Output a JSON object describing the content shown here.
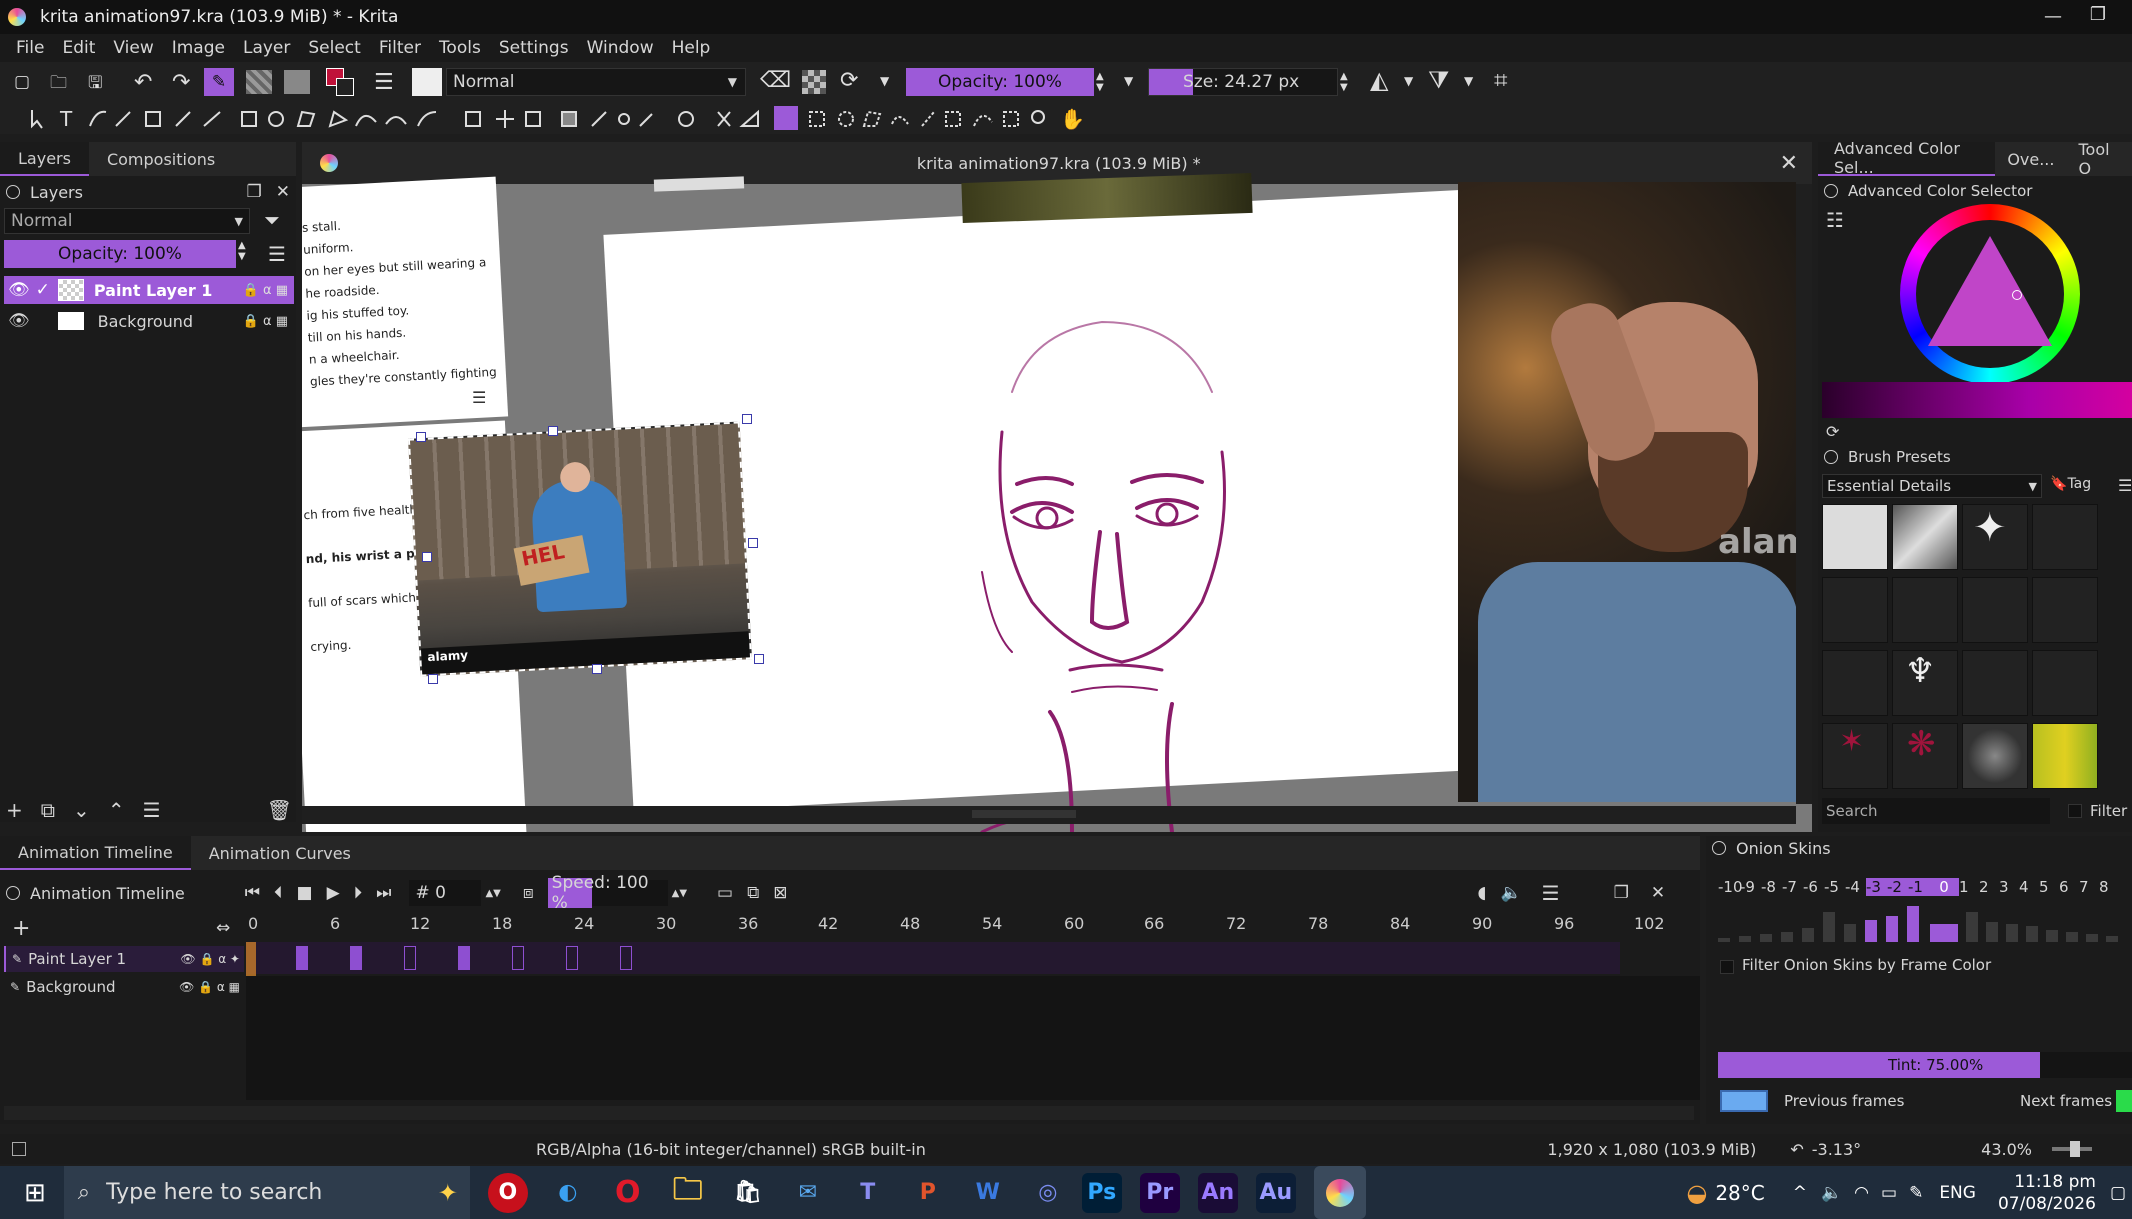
{
  "window": {
    "title": "krita animation97.kra (103.9 MiB) * - Krita"
  },
  "menu": [
    "File",
    "Edit",
    "View",
    "Image",
    "Layer",
    "Select",
    "Filter",
    "Tools",
    "Settings",
    "Window",
    "Help"
  ],
  "toolbar": {
    "blend_mode": "Normal",
    "opacity": "Opacity: 100%",
    "size_label_pre": "S",
    "size_label": "ze: 24.27 px"
  },
  "docker_left": {
    "tabs": [
      "Layers",
      "Compositions"
    ],
    "header": "Layers",
    "blend_mode": "Normal",
    "opacity": "Opacity: 100%",
    "layers": [
      {
        "name": "Paint Layer 1",
        "active": true
      },
      {
        "name": "Background",
        "active": false
      }
    ]
  },
  "canvas": {
    "doc_title": "krita animation97.kra (103.9 MiB) *",
    "ref_text_lines": [
      "s stall.",
      "uniform.",
      "on her eyes but still wearing a",
      "",
      "he roadside.",
      "ig his stuffed toy.",
      "till on his hands.",
      "n a wheelchair.",
      "",
      "gles they're constantly fighting"
    ],
    "ref_text_lines2": [
      "ch from five healthy tr",
      "nd, his wrist a pale grid",
      "full of scars which res",
      "",
      "crying."
    ],
    "sign_text": "HEL"
  },
  "docker_right": {
    "tabs": [
      "Advanced Color Sel...",
      "Ove...",
      "Tool O"
    ],
    "color_selector_title": "Advanced Color Selector",
    "accent_color": "#9c5ad8",
    "brush_presets_title": "Brush Presets",
    "preset_tag": "Essential Details",
    "tag_label": "Tag",
    "search_placeholder": "Search",
    "filter_label": "Filter"
  },
  "timeline": {
    "tabs": [
      "Animation Timeline",
      "Animation Curves"
    ],
    "header": "Animation Timeline",
    "frame": "# 0",
    "speed_label": "Speed: 100 %",
    "ticks": [
      "0",
      "6",
      "12",
      "18",
      "24",
      "30",
      "36",
      "42",
      "48",
      "54",
      "60",
      "66",
      "72",
      "78",
      "84",
      "90",
      "96",
      "102"
    ],
    "layers": [
      "Paint Layer 1",
      "Background"
    ]
  },
  "onion": {
    "title": "Onion Skins",
    "numbers": [
      "-10",
      "-9",
      "-8",
      "-7",
      "-6",
      "-5",
      "-4",
      "-3",
      "-2",
      "-1",
      "0",
      "1",
      "2",
      "3",
      "4",
      "5",
      "6",
      "7",
      "8"
    ],
    "filter_label": "Filter Onion Skins by Frame Color",
    "tint": "Tint: 75.00%",
    "prev_label": "Previous frames",
    "next_label": "Next frames"
  },
  "status": {
    "color_profile": "RGB/Alpha (16-bit integer/channel)  sRGB built-in",
    "dimensions": "1,920 x 1,080 (103.9 MiB)",
    "rotation": "-3.13°",
    "zoom": "43.0%"
  },
  "taskbar": {
    "search_placeholder": "Type here to search",
    "temperature": "28°C",
    "lang": "ENG",
    "time": "11:18 pm",
    "date": "07/08/2026",
    "apps": [
      "Ps",
      "Pr",
      "An",
      "Au"
    ]
  }
}
